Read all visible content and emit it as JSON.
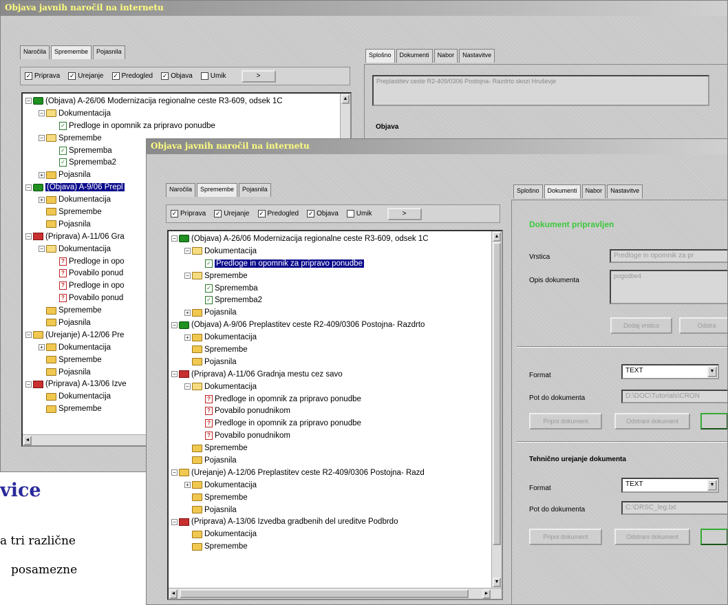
{
  "back": {
    "title": "Objava javnih naročil na internetu",
    "left_tabs": [
      "Naročila",
      "Spremembe",
      "Pojasnila"
    ],
    "checks": [
      {
        "label": "Priprava",
        "on": true
      },
      {
        "label": "Urejanje",
        "on": true
      },
      {
        "label": "Predogled",
        "on": true
      },
      {
        "label": "Objava",
        "on": true
      },
      {
        "label": "Umik",
        "on": false
      }
    ],
    "go": ">",
    "right_tabs": [
      "Splošno",
      "Dokumenti",
      "Nabor",
      "Nastavitve"
    ],
    "desc": "Preplastitev ceste R2-409/0306 Postojna- Razdrto skozi Hruševje",
    "section": "Objava",
    "tree": [
      {
        "d": 0,
        "pm": "-",
        "ic": "green",
        "t": "(Objava) A-26/06 Modernizacija regionalne ceste R3-609, odsek 1C"
      },
      {
        "d": 1,
        "pm": "-",
        "ic": "openfold",
        "t": "Dokumentacija"
      },
      {
        "d": 2,
        "ic": "doc",
        "t": "Predloge in opomnik za pripravo ponudbe"
      },
      {
        "d": 1,
        "pm": "-",
        "ic": "openfold",
        "t": "Spremembe"
      },
      {
        "d": 2,
        "ic": "doc",
        "t": "Sprememba"
      },
      {
        "d": 2,
        "ic": "doc",
        "t": "Sprememba2"
      },
      {
        "d": 1,
        "pm": "+",
        "ic": "fold",
        "t": "Pojasnila"
      },
      {
        "d": 0,
        "pm": "-",
        "ic": "green",
        "t": "(Objava) A-9/06 Prepl",
        "sel": true
      },
      {
        "d": 1,
        "pm": "+",
        "ic": "fold",
        "t": "Dokumentacija"
      },
      {
        "d": 1,
        "ic": "fold",
        "t": "Spremembe"
      },
      {
        "d": 1,
        "ic": "fold",
        "t": "Pojasnila"
      },
      {
        "d": 0,
        "pm": "-",
        "ic": "red",
        "t": "(Priprava) A-11/06 Gra"
      },
      {
        "d": 1,
        "pm": "-",
        "ic": "openfold",
        "t": "Dokumentacija"
      },
      {
        "d": 2,
        "ic": "docq",
        "t": "Predloge in opo"
      },
      {
        "d": 2,
        "ic": "docq",
        "t": "Povabilo ponud"
      },
      {
        "d": 2,
        "ic": "docq",
        "t": "Predloge in opo"
      },
      {
        "d": 2,
        "ic": "docq",
        "t": "Povabilo ponud"
      },
      {
        "d": 1,
        "ic": "fold",
        "t": "Spremembe"
      },
      {
        "d": 1,
        "ic": "fold",
        "t": "Pojasnila"
      },
      {
        "d": 0,
        "pm": "-",
        "ic": "fold",
        "t": "(Urejanje) A-12/06 Pre"
      },
      {
        "d": 1,
        "pm": "+",
        "ic": "fold",
        "t": "Dokumentacija"
      },
      {
        "d": 1,
        "ic": "fold",
        "t": "Spremembe"
      },
      {
        "d": 1,
        "ic": "fold",
        "t": "Pojasnila"
      },
      {
        "d": 0,
        "pm": "-",
        "ic": "red",
        "t": "(Priprava) A-13/06 Izve"
      },
      {
        "d": 1,
        "ic": "fold",
        "t": "Dokumentacija"
      },
      {
        "d": 1,
        "ic": "fold",
        "t": "Spremembe"
      }
    ]
  },
  "front": {
    "title": "Objava javnih naročil na internetu",
    "left_tabs": [
      "Naročila",
      "Spremembe",
      "Pojasnila"
    ],
    "checks": [
      {
        "label": "Priprava",
        "on": true
      },
      {
        "label": "Urejanje",
        "on": true
      },
      {
        "label": "Predogled",
        "on": true
      },
      {
        "label": "Objava",
        "on": true
      },
      {
        "label": "Umik",
        "on": false
      }
    ],
    "go": ">",
    "right_tabs": [
      "Splošno",
      "Dokumenti",
      "Nabor",
      "Nastavitve"
    ],
    "status": "Dokument pripravljen",
    "vrstica_label": "Vrstica",
    "vrstica_value": "Predloge in opomnik za pr",
    "opis_label": "Opis dokumenta",
    "opis_value": "pogodbe4",
    "btn_dodaj": "Dodaj vrstico",
    "btn_odstrani": "Odstra",
    "format_label": "Format",
    "format_value": "TEXT",
    "pot_label": "Pot do dokumenta",
    "pot_value": "D:\\DOC\\Tutorials\\CRON",
    "btn_pripni": "Pripni dokument",
    "btn_odstrani_dok": "Odstrani dokument",
    "tech_heading": "Tehnično urejanje dokumenta",
    "format2_label": "Format",
    "format2_value": "TEXT",
    "pot2_label": "Pot do dokumenta",
    "pot2_value": "C:\\DRSC_leg.txt",
    "btn_pripni2": "Pripni dokument",
    "btn_odstrani2": "Odstrani dokument",
    "tree": [
      {
        "d": 0,
        "pm": "-",
        "ic": "green",
        "t": "(Objava) A-26/06 Modernizacija regionalne ceste R3-609, odsek 1C"
      },
      {
        "d": 1,
        "pm": "-",
        "ic": "openfold",
        "t": "Dokumentacija"
      },
      {
        "d": 2,
        "ic": "doc",
        "t": "Predloge in opomnik za pripravo ponudbe",
        "sel": true
      },
      {
        "d": 1,
        "pm": "-",
        "ic": "openfold",
        "t": "Spremembe"
      },
      {
        "d": 2,
        "ic": "doc",
        "t": "Sprememba"
      },
      {
        "d": 2,
        "ic": "doc",
        "t": "Sprememba2"
      },
      {
        "d": 1,
        "pm": "+",
        "ic": "fold",
        "t": "Pojasnila"
      },
      {
        "d": 0,
        "pm": "-",
        "ic": "green",
        "t": "(Objava) A-9/06 Preplastitev ceste R2-409/0306 Postojna- Razdrto"
      },
      {
        "d": 1,
        "pm": "+",
        "ic": "fold",
        "t": "Dokumentacija"
      },
      {
        "d": 1,
        "ic": "fold",
        "t": "Spremembe"
      },
      {
        "d": 1,
        "ic": "fold",
        "t": "Pojasnila"
      },
      {
        "d": 0,
        "pm": "-",
        "ic": "red",
        "t": "(Priprava) A-11/06 Gradnja mestu cez savo"
      },
      {
        "d": 1,
        "pm": "-",
        "ic": "openfold",
        "t": "Dokumentacija"
      },
      {
        "d": 2,
        "ic": "docq",
        "t": "Predloge in opomnik za pripravo ponudbe"
      },
      {
        "d": 2,
        "ic": "docq",
        "t": "Povabilo ponudnikom"
      },
      {
        "d": 2,
        "ic": "docq",
        "t": "Predloge in opomnik za pripravo ponudbe"
      },
      {
        "d": 2,
        "ic": "docq",
        "t": "Povabilo ponudnikom"
      },
      {
        "d": 1,
        "ic": "fold",
        "t": "Spremembe"
      },
      {
        "d": 1,
        "ic": "fold",
        "t": "Pojasnila"
      },
      {
        "d": 0,
        "pm": "-",
        "ic": "fold",
        "t": "(Urejanje) A-12/06 Preplastitev ceste R2-409/0306 Postojna- Razd"
      },
      {
        "d": 1,
        "pm": "+",
        "ic": "fold",
        "t": "Dokumentacija"
      },
      {
        "d": 1,
        "ic": "fold",
        "t": "Spremembe"
      },
      {
        "d": 1,
        "ic": "fold",
        "t": "Pojasnila"
      },
      {
        "d": 0,
        "pm": "-",
        "ic": "red",
        "t": "(Priprava) A-13/06 Izvedba gradbenih del ureditve Podbrdo"
      },
      {
        "d": 1,
        "ic": "fold",
        "t": "Dokumentacija"
      },
      {
        "d": 1,
        "ic": "fold",
        "t": "Spremembe"
      }
    ]
  },
  "doc_fragment": {
    "heading": "vice",
    "line1": "a tri različne",
    "line2": "posamezne"
  },
  "colors": {
    "status_green": "#3cc83c",
    "heading_blue": "#2a2a9a",
    "title_yellow": "#ffff80",
    "selection": "#0a0a8c"
  }
}
